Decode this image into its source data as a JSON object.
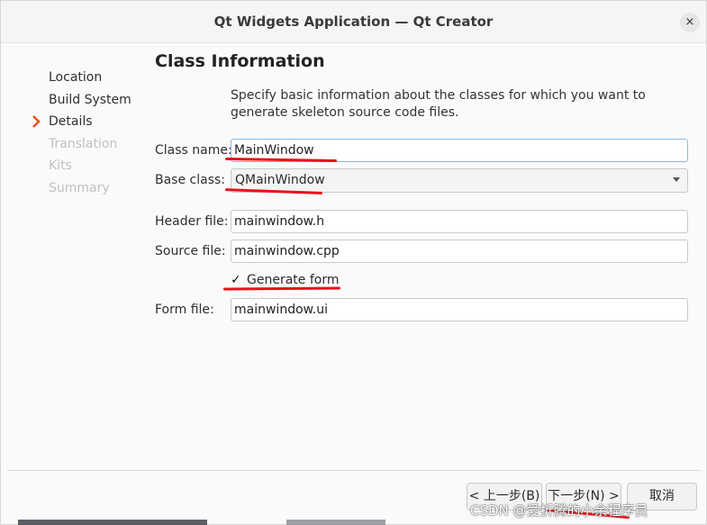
{
  "window": {
    "title": "Qt Widgets Application — Qt Creator",
    "close_glyph": "×"
  },
  "steps": [
    {
      "label": "Location",
      "state": "done"
    },
    {
      "label": "Build System",
      "state": "done"
    },
    {
      "label": "Details",
      "state": "current"
    },
    {
      "label": "Translation",
      "state": "future"
    },
    {
      "label": "Kits",
      "state": "future"
    },
    {
      "label": "Summary",
      "state": "future"
    }
  ],
  "page": {
    "heading": "Class Information",
    "description": "Specify basic information about the classes for which you want to generate skeleton source code files."
  },
  "form": {
    "class_name_label": "Class name:",
    "class_name_value": "MainWindow",
    "base_class_label": "Base class:",
    "base_class_value": "QMainWindow",
    "header_file_label": "Header file:",
    "header_file_value": "mainwindow.h",
    "source_file_label": "Source file:",
    "source_file_value": "mainwindow.cpp",
    "generate_form_label": "Generate form",
    "generate_form_checked": true,
    "check_glyph": "✓",
    "form_file_label": "Form file:",
    "form_file_value": "mainwindow.ui"
  },
  "buttons": {
    "back": "< 上一步(B)",
    "next": "下一步(N) >",
    "cancel": "取消"
  },
  "watermark": "CSDN @爱折腾的小余程序员",
  "colors": {
    "accent_arrow": "#e95420",
    "annotation_red": "#e8121a",
    "focus_border": "#8fb6e6"
  },
  "icons": {
    "current_step": "chevron-right-icon",
    "dropdown": "chevron-down-icon",
    "close": "close-icon"
  }
}
